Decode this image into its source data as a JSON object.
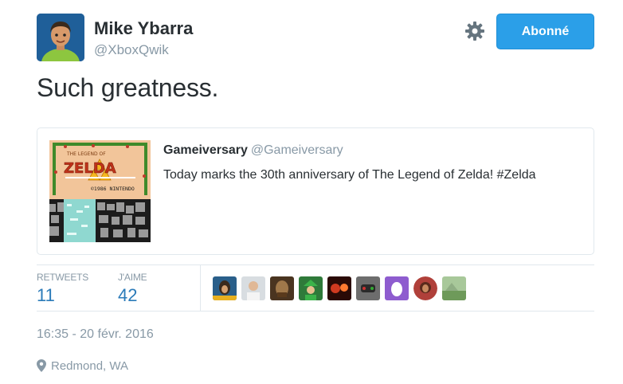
{
  "author": {
    "name": "Mike Ybarra",
    "handle": "@XboxQwik"
  },
  "actions": {
    "settings_icon": "gear-icon",
    "follow_label": "Abonné",
    "follow_color": "#2b9fe8"
  },
  "tweet": {
    "text": "Such greatness."
  },
  "quoted_tweet": {
    "name": "Gameiversary",
    "handle": "@Gameiversary",
    "text": "Today marks the 30th anniversary of The Legend of Zelda! #Zelda",
    "thumbnail": {
      "logo_small": "THE LEGEND OF",
      "logo_main": "ZELDA",
      "copyright": "©1986 NINTENDO"
    }
  },
  "stats": {
    "retweets_label": "RETWEETS",
    "retweets_count": "11",
    "likes_label": "J'AIME",
    "likes_count": "42",
    "count_color": "#2b7bb9"
  },
  "likers": [
    {
      "name": "avatar-1",
      "color": "#2a5f8a"
    },
    {
      "name": "avatar-2",
      "color": "#c9cfd4"
    },
    {
      "name": "avatar-3",
      "color": "#6b4a2c"
    },
    {
      "name": "avatar-4",
      "color": "#2f7a3a"
    },
    {
      "name": "avatar-5",
      "color": "#8a2a1c"
    },
    {
      "name": "avatar-6",
      "color": "#6d6d6d"
    },
    {
      "name": "avatar-7",
      "color": "#8e5ccf"
    },
    {
      "name": "avatar-8",
      "color": "#b0403a"
    },
    {
      "name": "avatar-9",
      "color": "#8fae84"
    }
  ],
  "meta": {
    "timestamp": "16:35 - 20 févr. 2016",
    "location": "Redmond, WA"
  }
}
